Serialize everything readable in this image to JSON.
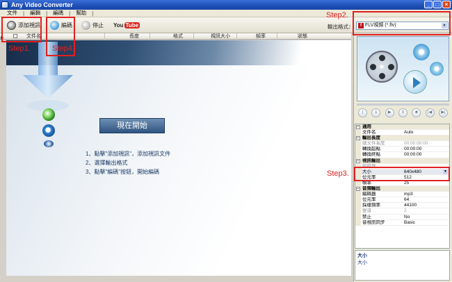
{
  "window": {
    "title": "Any Video Converter"
  },
  "menu": [
    "文件",
    "編輯",
    "編碼",
    "幫助"
  ],
  "toolbar": {
    "add_video": "添加視訊",
    "encode": "編碼",
    "stop": "停止",
    "youtube_you": "You",
    "youtube_tube": "Tube"
  },
  "output_format": {
    "label": "輸出格式：",
    "value": "FLV視頻 (*.flv)"
  },
  "file_list": {
    "columns": [
      "文件名",
      "長度",
      "格式",
      "視訊大小",
      "幀率",
      "狀態"
    ]
  },
  "main": {
    "start_button": "現在開始",
    "steps": [
      "1、點擊\"添加視訊\"，添加視訊文件",
      "2、選擇輸出格式",
      "3、點擊\"編碼\"按鈕，開始編碼"
    ]
  },
  "player": {
    "controls": [
      "⟨",
      "1",
      "▶",
      "‖",
      "■",
      "|◀",
      "▶|"
    ]
  },
  "properties": [
    {
      "type": "section",
      "k": "通用",
      "toggle": "−"
    },
    {
      "type": "row",
      "k": "文件名",
      "v": "Auto"
    },
    {
      "type": "section",
      "k": "輸出長度",
      "toggle": "−"
    },
    {
      "type": "row",
      "k": "總文件長度",
      "v": "00:00:00:00",
      "dim": true
    },
    {
      "type": "row",
      "k": "轉換起點",
      "v": "00:00:00"
    },
    {
      "type": "row",
      "k": "轉換終點",
      "v": "00:00:00"
    },
    {
      "type": "section",
      "k": "視訊輸出",
      "toggle": "−"
    },
    {
      "type": "row",
      "k": "編碼器",
      "v": "",
      "dim": true
    },
    {
      "type": "row",
      "k": "大小",
      "v": "640x480",
      "selected": true,
      "dropdown": true
    },
    {
      "type": "row",
      "k": "位元率",
      "v": "512"
    },
    {
      "type": "row",
      "k": "幀率",
      "v": "25"
    },
    {
      "type": "section",
      "k": "音頻輸出",
      "toggle": "−"
    },
    {
      "type": "row",
      "k": "編碼器",
      "v": "mp3"
    },
    {
      "type": "row",
      "k": "位元率",
      "v": "64"
    },
    {
      "type": "row",
      "k": "採樣頻率",
      "v": "44100"
    },
    {
      "type": "row",
      "k": "聲道",
      "v": "2",
      "dim": true
    },
    {
      "type": "row",
      "k": "禁止",
      "v": "No"
    },
    {
      "type": "row",
      "k": "音視訊同步",
      "v": "Basic"
    }
  ],
  "description": {
    "title": "大小",
    "text": "大小"
  },
  "annotations": [
    "Step1.",
    "Step4.",
    "Step2.",
    "Step3."
  ],
  "colors": {
    "annotation": "#e02020",
    "titlebar": "#1d4fb5"
  }
}
